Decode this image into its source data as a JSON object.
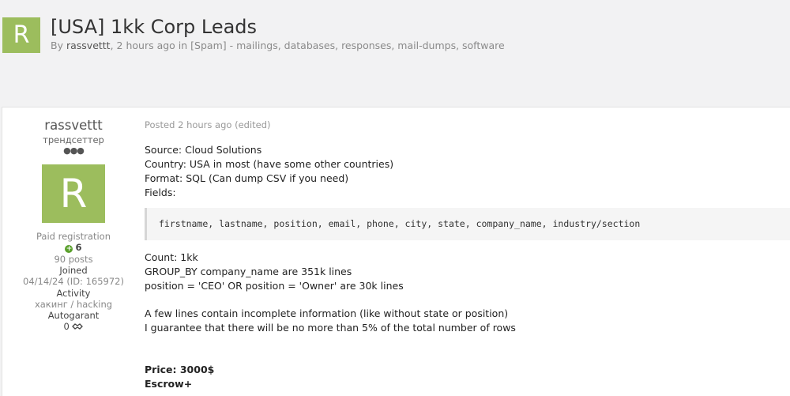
{
  "topic": {
    "avatar_letter": "R",
    "title": "[USA] 1kk Corp Leads",
    "by_prefix": "By",
    "author": "rassvettt",
    "time": ", 2 hours ago in ",
    "forum": "[Spam] - mailings, databases, responses, mail-dumps, software"
  },
  "author": {
    "name": "rassvettt",
    "rank": "трендсеттер",
    "rank_pips": "●●●",
    "avatar_letter": "R",
    "group": "Paid registration",
    "reputation": "6",
    "posts": "90 posts",
    "joined_label": "Joined",
    "joined_value": "04/14/24 (ID: 165972)",
    "activity_label": "Activity",
    "activity_value": "хакинг / hacking",
    "autogarant_label": "Autogarant",
    "autogarant_value": "0"
  },
  "post": {
    "posted": "Posted 2 hours ago (edited)",
    "lines": [
      "Source: Cloud Solutions",
      "Country: USA in most (have some other countries)",
      "Format: SQL (Can dump CSV if you need)",
      "Fields:"
    ],
    "code": "firstname, lastname, position, email, phone, city, state, company_name, industry/section",
    "stats": [
      "Count: 1kk",
      "GROUP_BY company_name are 351k lines",
      "position = 'CEO' OR position = 'Owner' are 30k lines"
    ],
    "notes": [
      "A few lines contain incomplete information (like without state or position)",
      "I guarantee that there will be no more than 5% of the total number of rows"
    ],
    "price": "Price: 3000$",
    "escrow": "Escrow+"
  },
  "colors": {
    "avatar_bg": "#9cbd5d",
    "reputation_green": "#5aa02c"
  }
}
